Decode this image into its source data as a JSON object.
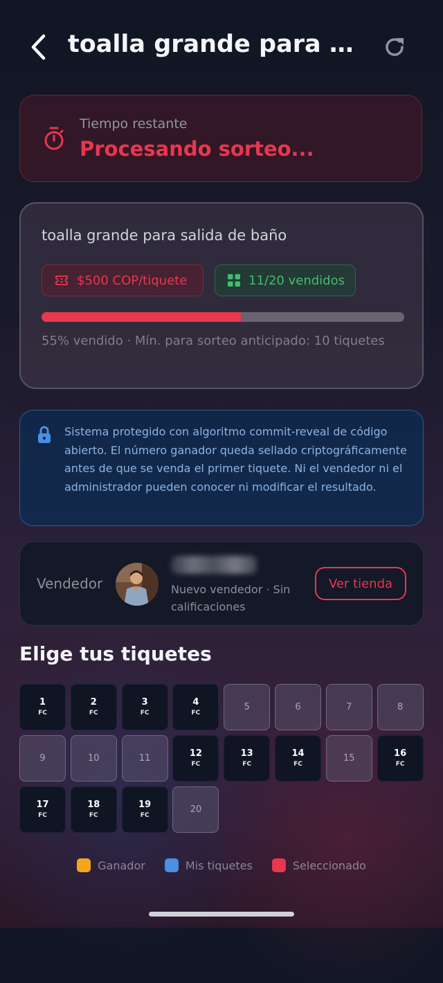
{
  "header": {
    "title": "toalla grande para sal..."
  },
  "timer": {
    "label": "Tiempo restante",
    "value": "Procesando sorteo..."
  },
  "product": {
    "name": "toalla grande para salida de baño",
    "price_badge": "$500 COP/tiquete",
    "sold_badge": "11/20 vendidos",
    "progress_fraction": 0.55,
    "footer": "55% vendido · Mín. para sorteo anticipado: 10 tiquetes"
  },
  "security": {
    "text": "Sistema protegido con algoritmo commit-reveal de código abierto. El número ganador queda sellado criptográficamente antes de que se venda el primer tiquete. Ni el vendedor ni el administrador pueden conocer ni modificar el resultado."
  },
  "seller": {
    "label": "Vendedor",
    "subtitle": "Nuevo vendedor · Sin calificaciones",
    "store_button": "Ver tienda"
  },
  "tickets": {
    "title": "Elige tus tiquetes",
    "items": [
      {
        "num": "1",
        "code": "FC",
        "status": "sold"
      },
      {
        "num": "2",
        "code": "FC",
        "status": "sold"
      },
      {
        "num": "3",
        "code": "FC",
        "status": "sold"
      },
      {
        "num": "4",
        "code": "FC",
        "status": "sold"
      },
      {
        "num": "5",
        "code": "",
        "status": "available"
      },
      {
        "num": "6",
        "code": "",
        "status": "available"
      },
      {
        "num": "7",
        "code": "",
        "status": "available"
      },
      {
        "num": "8",
        "code": "",
        "status": "available"
      },
      {
        "num": "9",
        "code": "",
        "status": "available"
      },
      {
        "num": "10",
        "code": "",
        "status": "available"
      },
      {
        "num": "11",
        "code": "",
        "status": "available"
      },
      {
        "num": "12",
        "code": "FC",
        "status": "sold"
      },
      {
        "num": "13",
        "code": "FC",
        "status": "sold"
      },
      {
        "num": "14",
        "code": "FC",
        "status": "sold"
      },
      {
        "num": "15",
        "code": "",
        "status": "available"
      },
      {
        "num": "16",
        "code": "FC",
        "status": "sold"
      },
      {
        "num": "17",
        "code": "FC",
        "status": "sold"
      },
      {
        "num": "18",
        "code": "FC",
        "status": "sold"
      },
      {
        "num": "19",
        "code": "FC",
        "status": "sold"
      },
      {
        "num": "20",
        "code": "",
        "status": "available"
      }
    ]
  },
  "legend": [
    {
      "label": "Ganador",
      "color": "#f4a51c"
    },
    {
      "label": "Mis tiquetes",
      "color": "#4a90e2"
    },
    {
      "label": "Seleccionado",
      "color": "#e8374f"
    }
  ],
  "colors": {
    "accent": "#e8374f",
    "success": "#3fbf6e",
    "info": "#8bb3e3"
  },
  "icons": [
    "back-arrow-icon",
    "refresh-icon",
    "stopwatch-icon",
    "ticket-icon",
    "grid-icon",
    "lock-icon"
  ]
}
